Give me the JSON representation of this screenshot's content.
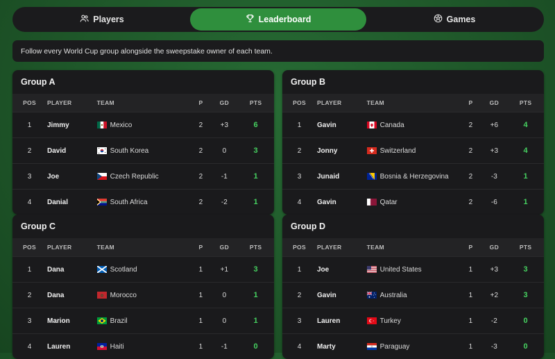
{
  "tabs": [
    {
      "label": "Players",
      "icon": "users-icon",
      "active": false
    },
    {
      "label": "Leaderboard",
      "icon": "trophy-icon",
      "active": true
    },
    {
      "label": "Games",
      "icon": "soccer-ball-icon",
      "active": false
    }
  ],
  "info_text": "Follow every World Cup group alongside the sweepstake owner of each team.",
  "columns": {
    "pos": "POS",
    "player": "PLAYER",
    "team": "TEAM",
    "p": "P",
    "gd": "GD",
    "pts": "PTS"
  },
  "colors": {
    "accent": "#2f8f3d",
    "points": "#46d160"
  },
  "groups": [
    {
      "title": "Group A",
      "rows": [
        {
          "pos": "1",
          "player": "Jimmy",
          "team": "Mexico",
          "flag": "mexico",
          "p": "2",
          "gd": "+3",
          "pts": "6"
        },
        {
          "pos": "2",
          "player": "David",
          "team": "South Korea",
          "flag": "south-korea",
          "p": "2",
          "gd": "0",
          "pts": "3"
        },
        {
          "pos": "3",
          "player": "Joe",
          "team": "Czech Republic",
          "flag": "czech",
          "p": "2",
          "gd": "-1",
          "pts": "1"
        },
        {
          "pos": "4",
          "player": "Danial",
          "team": "South Africa",
          "flag": "south-africa",
          "p": "2",
          "gd": "-2",
          "pts": "1"
        }
      ]
    },
    {
      "title": "Group B",
      "rows": [
        {
          "pos": "1",
          "player": "Gavin",
          "team": "Canada",
          "flag": "canada",
          "p": "2",
          "gd": "+6",
          "pts": "4"
        },
        {
          "pos": "2",
          "player": "Jonny",
          "team": "Switzerland",
          "flag": "switzerland",
          "p": "2",
          "gd": "+3",
          "pts": "4"
        },
        {
          "pos": "3",
          "player": "Junaid",
          "team": "Bosnia & Herzegovina",
          "flag": "bosnia",
          "p": "2",
          "gd": "-3",
          "pts": "1"
        },
        {
          "pos": "4",
          "player": "Gavin",
          "team": "Qatar",
          "flag": "qatar",
          "p": "2",
          "gd": "-6",
          "pts": "1"
        }
      ]
    },
    {
      "title": "Group C",
      "rows": [
        {
          "pos": "1",
          "player": "Dana",
          "team": "Scotland",
          "flag": "scotland",
          "p": "1",
          "gd": "+1",
          "pts": "3"
        },
        {
          "pos": "2",
          "player": "Dana",
          "team": "Morocco",
          "flag": "morocco",
          "p": "1",
          "gd": "0",
          "pts": "1"
        },
        {
          "pos": "3",
          "player": "Marion",
          "team": "Brazil",
          "flag": "brazil",
          "p": "1",
          "gd": "0",
          "pts": "1"
        },
        {
          "pos": "4",
          "player": "Lauren",
          "team": "Haiti",
          "flag": "haiti",
          "p": "1",
          "gd": "-1",
          "pts": "0"
        }
      ]
    },
    {
      "title": "Group D",
      "rows": [
        {
          "pos": "1",
          "player": "Joe",
          "team": "United States",
          "flag": "usa",
          "p": "1",
          "gd": "+3",
          "pts": "3"
        },
        {
          "pos": "2",
          "player": "Gavin",
          "team": "Australia",
          "flag": "australia",
          "p": "1",
          "gd": "+2",
          "pts": "3"
        },
        {
          "pos": "3",
          "player": "Lauren",
          "team": "Turkey",
          "flag": "turkey",
          "p": "1",
          "gd": "-2",
          "pts": "0"
        },
        {
          "pos": "4",
          "player": "Marty",
          "team": "Paraguay",
          "flag": "paraguay",
          "p": "1",
          "gd": "-3",
          "pts": "0"
        }
      ]
    }
  ]
}
